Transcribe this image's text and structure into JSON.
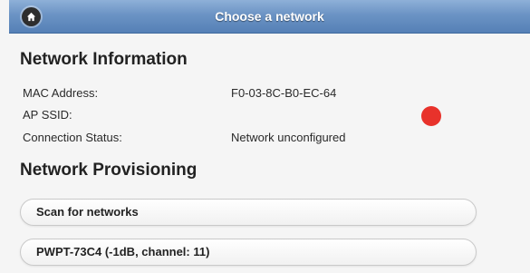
{
  "header": {
    "title": "Choose a network",
    "home_icon": "home-icon",
    "bar_color": "#6b93c4"
  },
  "network_info": {
    "title": "Network Information",
    "rows": [
      {
        "label": "MAC Address:",
        "value": "F0-03-8C-B0-EC-64"
      },
      {
        "label": "AP SSID:",
        "value": ""
      },
      {
        "label": "Connection Status:",
        "value": "Network unconfigured"
      }
    ],
    "status_indicator_color": "#e8322b"
  },
  "provisioning": {
    "title": "Network Provisioning",
    "scan_label": "Scan for networks",
    "networks": [
      {
        "label": "PWPT-73C4 (-1dB, channel: 11)"
      }
    ]
  }
}
